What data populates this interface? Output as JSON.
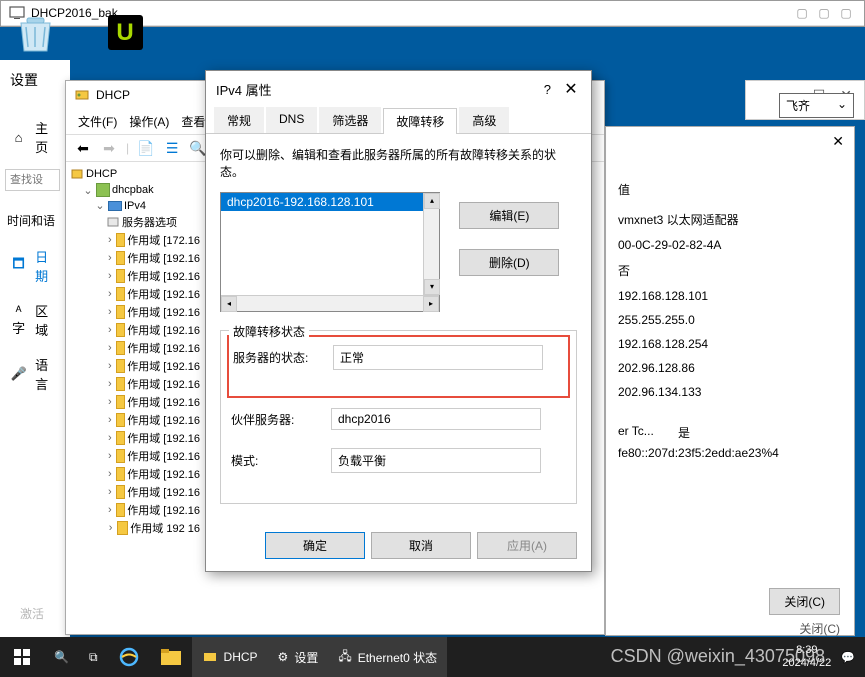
{
  "vm": {
    "title": "DHCP2016_bak"
  },
  "settings": {
    "title": "设置",
    "search_placeholder": "查找设",
    "home": "主页",
    "section": "时间和语",
    "items": [
      {
        "icon": "🗕",
        "label": "日期"
      },
      {
        "icon": "ᴬ字",
        "label": "区域"
      },
      {
        "icon": "🎤",
        "label": "语言"
      }
    ]
  },
  "dhcp": {
    "title": "DHCP",
    "menu": [
      {
        "label": "文件(F)"
      },
      {
        "label": "操作(A)"
      },
      {
        "label": "查看(V)"
      }
    ],
    "tree": {
      "root": "DHCP",
      "server": "dhcpbak",
      "ipv4": "IPv4",
      "options": "服务器选项",
      "scopes": [
        "作用域 [172.16",
        "作用域 [192.16",
        "作用域 [192.16",
        "作用域 [192.16",
        "作用域 [192.16",
        "作用域 [192.16",
        "作用域 [192.16",
        "作用域 [192.16",
        "作用域 [192.16",
        "作用域 [192.16",
        "作用域 [192.16",
        "作用域 [192.16",
        "作用域 [192.16",
        "作用域 [192.16",
        "作用域 [192.16",
        "作用域 [192.16",
        "作用域 192 16"
      ]
    }
  },
  "ipv4_dialog": {
    "title": "IPv4 属性",
    "tabs": [
      "常规",
      "DNS",
      "筛选器",
      "故障转移",
      "高级"
    ],
    "active_tab": 3,
    "desc": "你可以删除、编辑和查看此服务器所属的所有故障转移关系的状态。",
    "list_item": "dhcp2016-192.168.128.101",
    "edit_btn": "编辑(E)",
    "delete_btn": "删除(D)",
    "status_group": "故障转移状态",
    "server_status_label": "服务器的状态:",
    "server_status_value": "正常",
    "partner_label": "伙伴服务器:",
    "partner_value": "dhcp2016",
    "mode_label": "模式:",
    "mode_value": "负载平衡",
    "ok": "确定",
    "cancel": "取消",
    "apply": "应用(A)"
  },
  "props": {
    "search": "飞齐",
    "header": "值",
    "items": [
      "vmxnet3 以太网适配器",
      "00-0C-29-02-82-4A",
      "否",
      "192.168.128.101",
      "255.255.255.0",
      "192.168.128.254",
      "202.96.128.86",
      "202.96.134.133"
    ],
    "extra_label": "er Tc...",
    "extra_value": "是",
    "ipv6": "fe80::207d:23f5:2edd:ae23%4",
    "close_btn": "关闭(C)",
    "close_btn2": "关闭(C)"
  },
  "activate": "激活",
  "taskbar": {
    "dhcp_label": "DHCP",
    "settings_label": "设置",
    "ethernet_label": "Ethernet0 状态",
    "time": "8:39",
    "date": "2024/4/22"
  },
  "watermark": "CSDN @weixin_43075098"
}
